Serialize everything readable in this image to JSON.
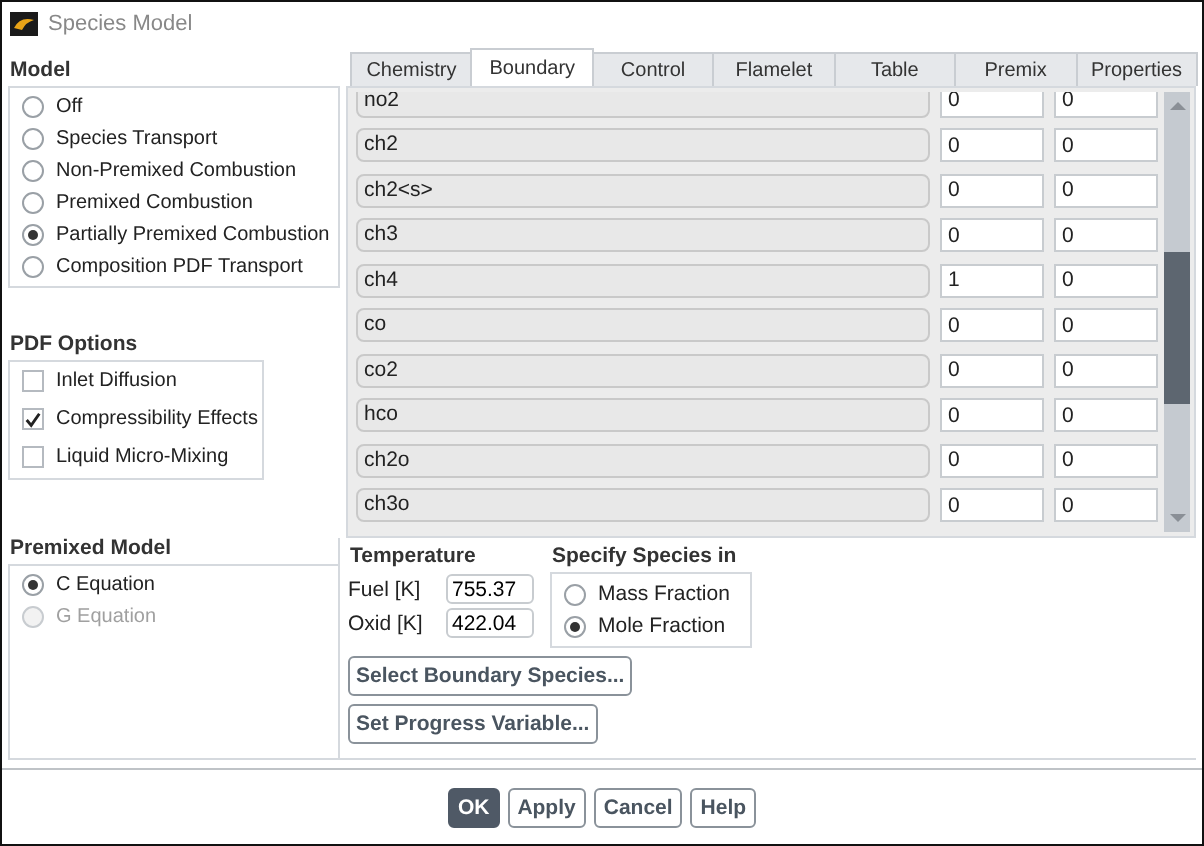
{
  "window": {
    "title": "Species Model"
  },
  "model": {
    "label": "Model",
    "options": [
      {
        "label": "Off",
        "selected": false
      },
      {
        "label": "Species Transport",
        "selected": false
      },
      {
        "label": "Non-Premixed Combustion",
        "selected": false
      },
      {
        "label": "Premixed Combustion",
        "selected": false
      },
      {
        "label": "Partially Premixed Combustion",
        "selected": true
      },
      {
        "label": "Composition PDF Transport",
        "selected": false
      }
    ]
  },
  "pdf_options": {
    "label": "PDF Options",
    "options": [
      {
        "label": "Inlet Diffusion",
        "checked": false
      },
      {
        "label": "Compressibility Effects",
        "checked": true
      },
      {
        "label": "Liquid Micro-Mixing",
        "checked": false
      }
    ]
  },
  "premixed_model": {
    "label": "Premixed Model",
    "options": [
      {
        "label": "C Equation",
        "selected": true,
        "disabled": false
      },
      {
        "label": "G Equation",
        "selected": false,
        "disabled": true
      }
    ]
  },
  "tabs": [
    {
      "label": "Chemistry",
      "selected": false
    },
    {
      "label": "Boundary",
      "selected": true
    },
    {
      "label": "Control",
      "selected": false
    },
    {
      "label": "Flamelet",
      "selected": false
    },
    {
      "label": "Table",
      "selected": false
    },
    {
      "label": "Premix",
      "selected": false
    },
    {
      "label": "Properties",
      "selected": false
    }
  ],
  "species": [
    {
      "name": "no2",
      "fuel": "0",
      "oxid": "0"
    },
    {
      "name": "ch2",
      "fuel": "0",
      "oxid": "0"
    },
    {
      "name": "ch2<s>",
      "fuel": "0",
      "oxid": "0"
    },
    {
      "name": "ch3",
      "fuel": "0",
      "oxid": "0"
    },
    {
      "name": "ch4",
      "fuel": "1",
      "oxid": "0"
    },
    {
      "name": "co",
      "fuel": "0",
      "oxid": "0"
    },
    {
      "name": "co2",
      "fuel": "0",
      "oxid": "0"
    },
    {
      "name": "hco",
      "fuel": "0",
      "oxid": "0"
    },
    {
      "name": "ch2o",
      "fuel": "0",
      "oxid": "0"
    },
    {
      "name": "ch3o",
      "fuel": "0",
      "oxid": "0"
    }
  ],
  "temperature": {
    "label": "Temperature",
    "fields": [
      {
        "label": "Fuel [K]",
        "value": "755.37"
      },
      {
        "label": "Oxid [K]",
        "value": "422.04"
      }
    ]
  },
  "specify_species_in": {
    "label": "Specify Species in",
    "options": [
      {
        "label": "Mass Fraction",
        "selected": false
      },
      {
        "label": "Mole Fraction",
        "selected": true
      }
    ]
  },
  "panel_buttons": [
    "Select Boundary Species...",
    "Set Progress Variable..."
  ],
  "buttons": [
    {
      "label": "OK",
      "default": true
    },
    {
      "label": "Apply",
      "default": false
    },
    {
      "label": "Cancel",
      "default": false
    },
    {
      "label": "Help",
      "default": false
    }
  ]
}
